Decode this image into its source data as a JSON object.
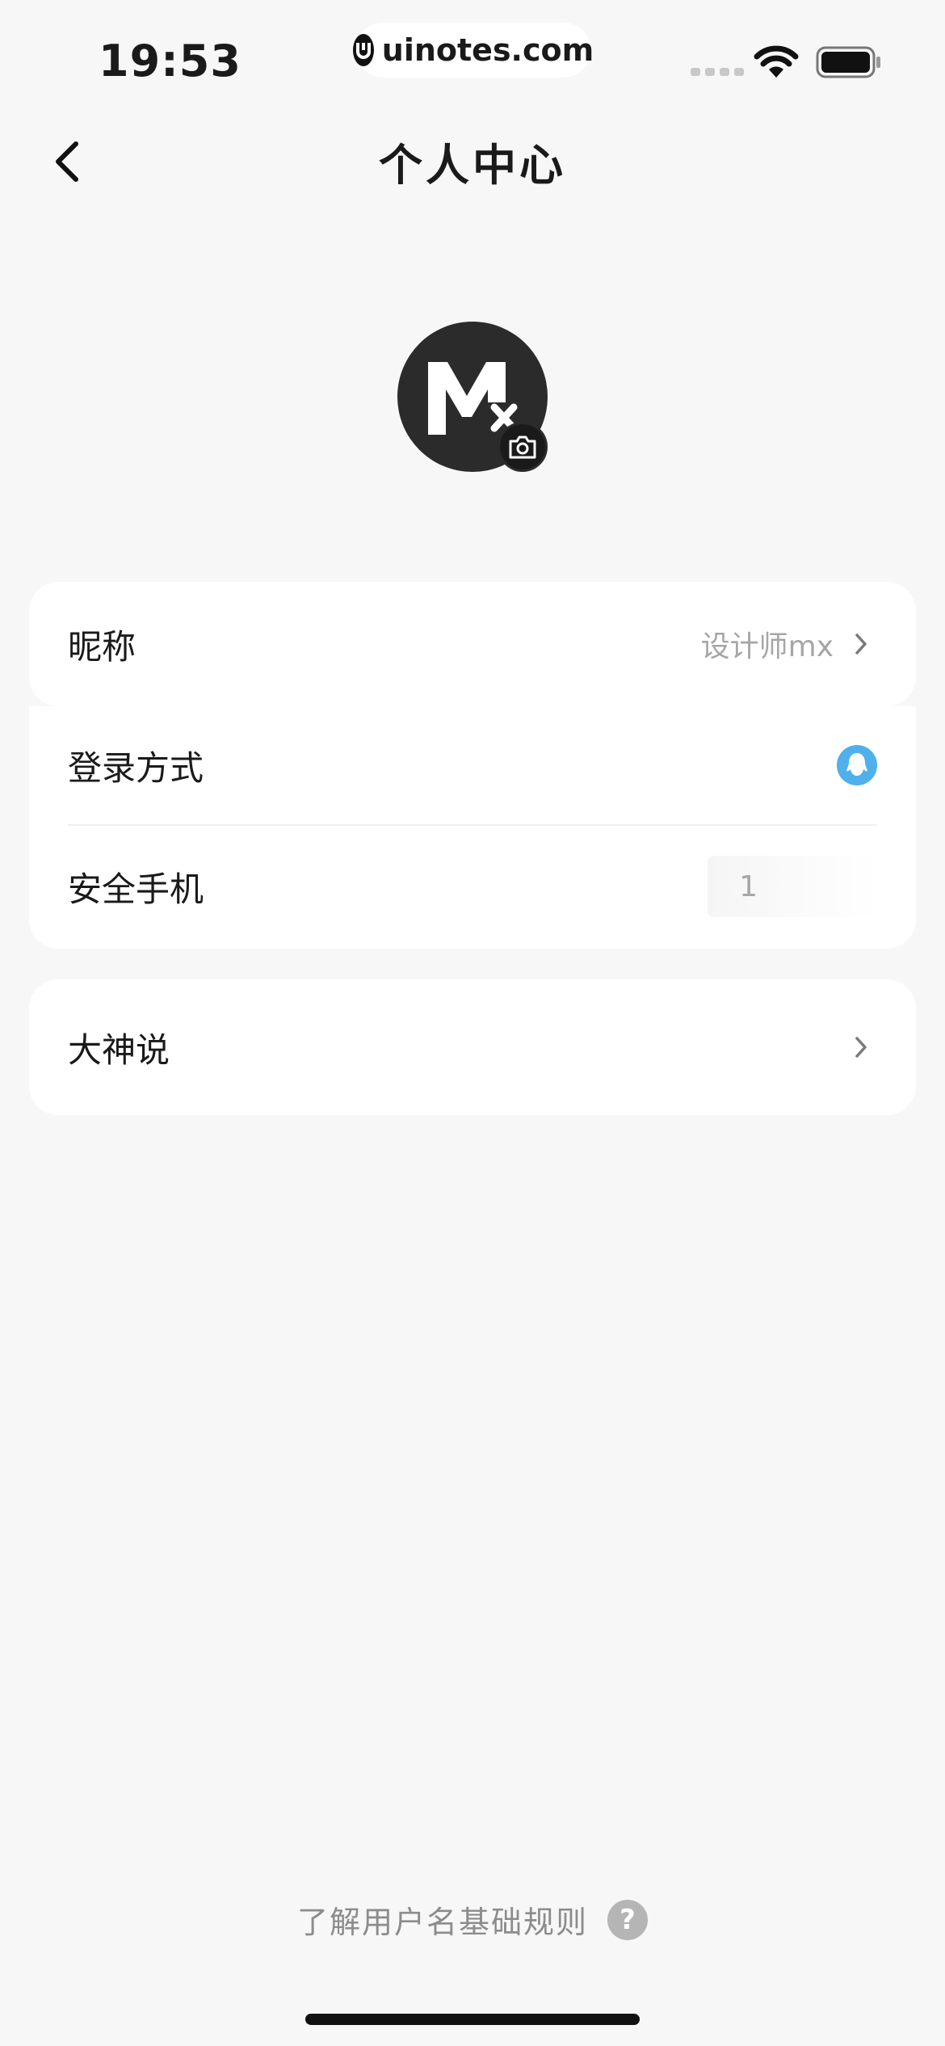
{
  "status_bar": {
    "time": "19:53",
    "url": "uinotes.com",
    "icons": [
      "signal-icon",
      "wifi-icon",
      "battery-icon"
    ]
  },
  "nav": {
    "back_icon": "chevron-left-icon",
    "title": "个人中心"
  },
  "profile": {
    "avatar_icon": "mx-logo-icon",
    "camera_icon": "camera-icon"
  },
  "settings": {
    "nickname": {
      "label": "昵称",
      "value": "设计师mx"
    },
    "login_method": {
      "label": "登录方式",
      "icon": "qq-icon",
      "icon_color": "#4fb0ec"
    },
    "security_phone": {
      "label": "安全手机",
      "value": "1"
    },
    "dashen": {
      "label": "大神说"
    }
  },
  "footer": {
    "rules_text": "了解用户名基础规则",
    "help_symbol": "?"
  },
  "colors": {
    "background": "#f7f7f7",
    "card": "#ffffff",
    "secondary_text": "#a6a6a6",
    "accent_qq": "#4fb0ec"
  }
}
